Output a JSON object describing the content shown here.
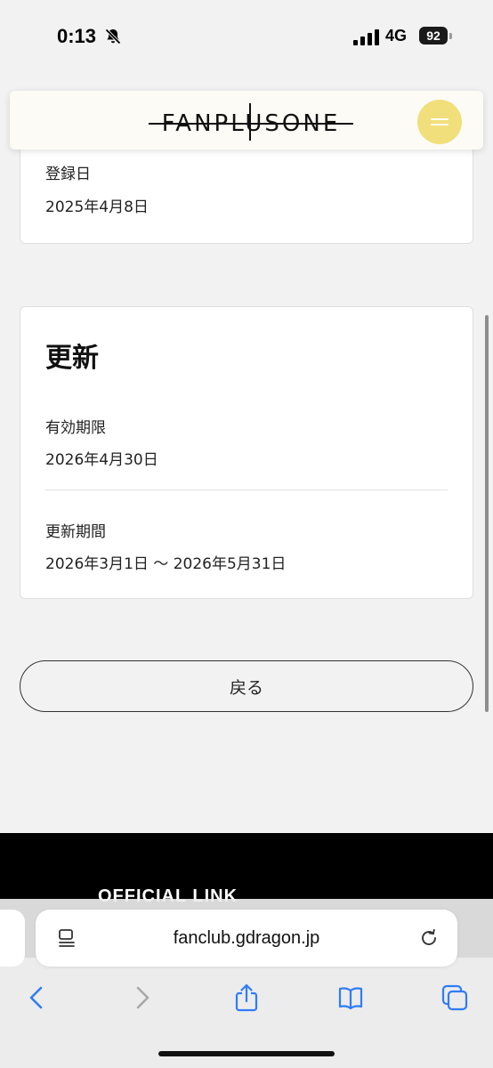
{
  "status_bar": {
    "time": "0:13",
    "network": "4G",
    "battery": "92"
  },
  "header": {
    "logo_text": "FANPLUSONE"
  },
  "registration": {
    "label": "登録日",
    "value": "2025年4月8日"
  },
  "renewal": {
    "title": "更新",
    "expiry_label": "有効期限",
    "expiry_value": "2026年4月30日",
    "period_label": "更新期間",
    "period_value": "2026年3月1日 〜 2026年5月31日"
  },
  "back_button_label": "戻る",
  "footer": {
    "heading": "OFFICIAL LINK"
  },
  "browser": {
    "url": "fanclub.gdragon.jp"
  },
  "colors": {
    "accent": "#f1df7b",
    "background": "#f2f2f2",
    "browser_blue": "#2f7cf6"
  }
}
